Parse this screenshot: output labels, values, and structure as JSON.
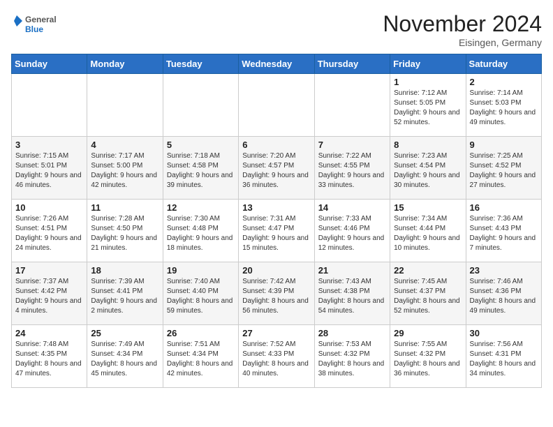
{
  "header": {
    "logo_general": "General",
    "logo_blue": "Blue",
    "month_title": "November 2024",
    "location": "Eisingen, Germany"
  },
  "days_of_week": [
    "Sunday",
    "Monday",
    "Tuesday",
    "Wednesday",
    "Thursday",
    "Friday",
    "Saturday"
  ],
  "weeks": [
    [
      {
        "day": "",
        "info": ""
      },
      {
        "day": "",
        "info": ""
      },
      {
        "day": "",
        "info": ""
      },
      {
        "day": "",
        "info": ""
      },
      {
        "day": "",
        "info": ""
      },
      {
        "day": "1",
        "info": "Sunrise: 7:12 AM\nSunset: 5:05 PM\nDaylight: 9 hours and 52 minutes."
      },
      {
        "day": "2",
        "info": "Sunrise: 7:14 AM\nSunset: 5:03 PM\nDaylight: 9 hours and 49 minutes."
      }
    ],
    [
      {
        "day": "3",
        "info": "Sunrise: 7:15 AM\nSunset: 5:01 PM\nDaylight: 9 hours and 46 minutes."
      },
      {
        "day": "4",
        "info": "Sunrise: 7:17 AM\nSunset: 5:00 PM\nDaylight: 9 hours and 42 minutes."
      },
      {
        "day": "5",
        "info": "Sunrise: 7:18 AM\nSunset: 4:58 PM\nDaylight: 9 hours and 39 minutes."
      },
      {
        "day": "6",
        "info": "Sunrise: 7:20 AM\nSunset: 4:57 PM\nDaylight: 9 hours and 36 minutes."
      },
      {
        "day": "7",
        "info": "Sunrise: 7:22 AM\nSunset: 4:55 PM\nDaylight: 9 hours and 33 minutes."
      },
      {
        "day": "8",
        "info": "Sunrise: 7:23 AM\nSunset: 4:54 PM\nDaylight: 9 hours and 30 minutes."
      },
      {
        "day": "9",
        "info": "Sunrise: 7:25 AM\nSunset: 4:52 PM\nDaylight: 9 hours and 27 minutes."
      }
    ],
    [
      {
        "day": "10",
        "info": "Sunrise: 7:26 AM\nSunset: 4:51 PM\nDaylight: 9 hours and 24 minutes."
      },
      {
        "day": "11",
        "info": "Sunrise: 7:28 AM\nSunset: 4:50 PM\nDaylight: 9 hours and 21 minutes."
      },
      {
        "day": "12",
        "info": "Sunrise: 7:30 AM\nSunset: 4:48 PM\nDaylight: 9 hours and 18 minutes."
      },
      {
        "day": "13",
        "info": "Sunrise: 7:31 AM\nSunset: 4:47 PM\nDaylight: 9 hours and 15 minutes."
      },
      {
        "day": "14",
        "info": "Sunrise: 7:33 AM\nSunset: 4:46 PM\nDaylight: 9 hours and 12 minutes."
      },
      {
        "day": "15",
        "info": "Sunrise: 7:34 AM\nSunset: 4:44 PM\nDaylight: 9 hours and 10 minutes."
      },
      {
        "day": "16",
        "info": "Sunrise: 7:36 AM\nSunset: 4:43 PM\nDaylight: 9 hours and 7 minutes."
      }
    ],
    [
      {
        "day": "17",
        "info": "Sunrise: 7:37 AM\nSunset: 4:42 PM\nDaylight: 9 hours and 4 minutes."
      },
      {
        "day": "18",
        "info": "Sunrise: 7:39 AM\nSunset: 4:41 PM\nDaylight: 9 hours and 2 minutes."
      },
      {
        "day": "19",
        "info": "Sunrise: 7:40 AM\nSunset: 4:40 PM\nDaylight: 8 hours and 59 minutes."
      },
      {
        "day": "20",
        "info": "Sunrise: 7:42 AM\nSunset: 4:39 PM\nDaylight: 8 hours and 56 minutes."
      },
      {
        "day": "21",
        "info": "Sunrise: 7:43 AM\nSunset: 4:38 PM\nDaylight: 8 hours and 54 minutes."
      },
      {
        "day": "22",
        "info": "Sunrise: 7:45 AM\nSunset: 4:37 PM\nDaylight: 8 hours and 52 minutes."
      },
      {
        "day": "23",
        "info": "Sunrise: 7:46 AM\nSunset: 4:36 PM\nDaylight: 8 hours and 49 minutes."
      }
    ],
    [
      {
        "day": "24",
        "info": "Sunrise: 7:48 AM\nSunset: 4:35 PM\nDaylight: 8 hours and 47 minutes."
      },
      {
        "day": "25",
        "info": "Sunrise: 7:49 AM\nSunset: 4:34 PM\nDaylight: 8 hours and 45 minutes."
      },
      {
        "day": "26",
        "info": "Sunrise: 7:51 AM\nSunset: 4:34 PM\nDaylight: 8 hours and 42 minutes."
      },
      {
        "day": "27",
        "info": "Sunrise: 7:52 AM\nSunset: 4:33 PM\nDaylight: 8 hours and 40 minutes."
      },
      {
        "day": "28",
        "info": "Sunrise: 7:53 AM\nSunset: 4:32 PM\nDaylight: 8 hours and 38 minutes."
      },
      {
        "day": "29",
        "info": "Sunrise: 7:55 AM\nSunset: 4:32 PM\nDaylight: 8 hours and 36 minutes."
      },
      {
        "day": "30",
        "info": "Sunrise: 7:56 AM\nSunset: 4:31 PM\nDaylight: 8 hours and 34 minutes."
      }
    ]
  ]
}
